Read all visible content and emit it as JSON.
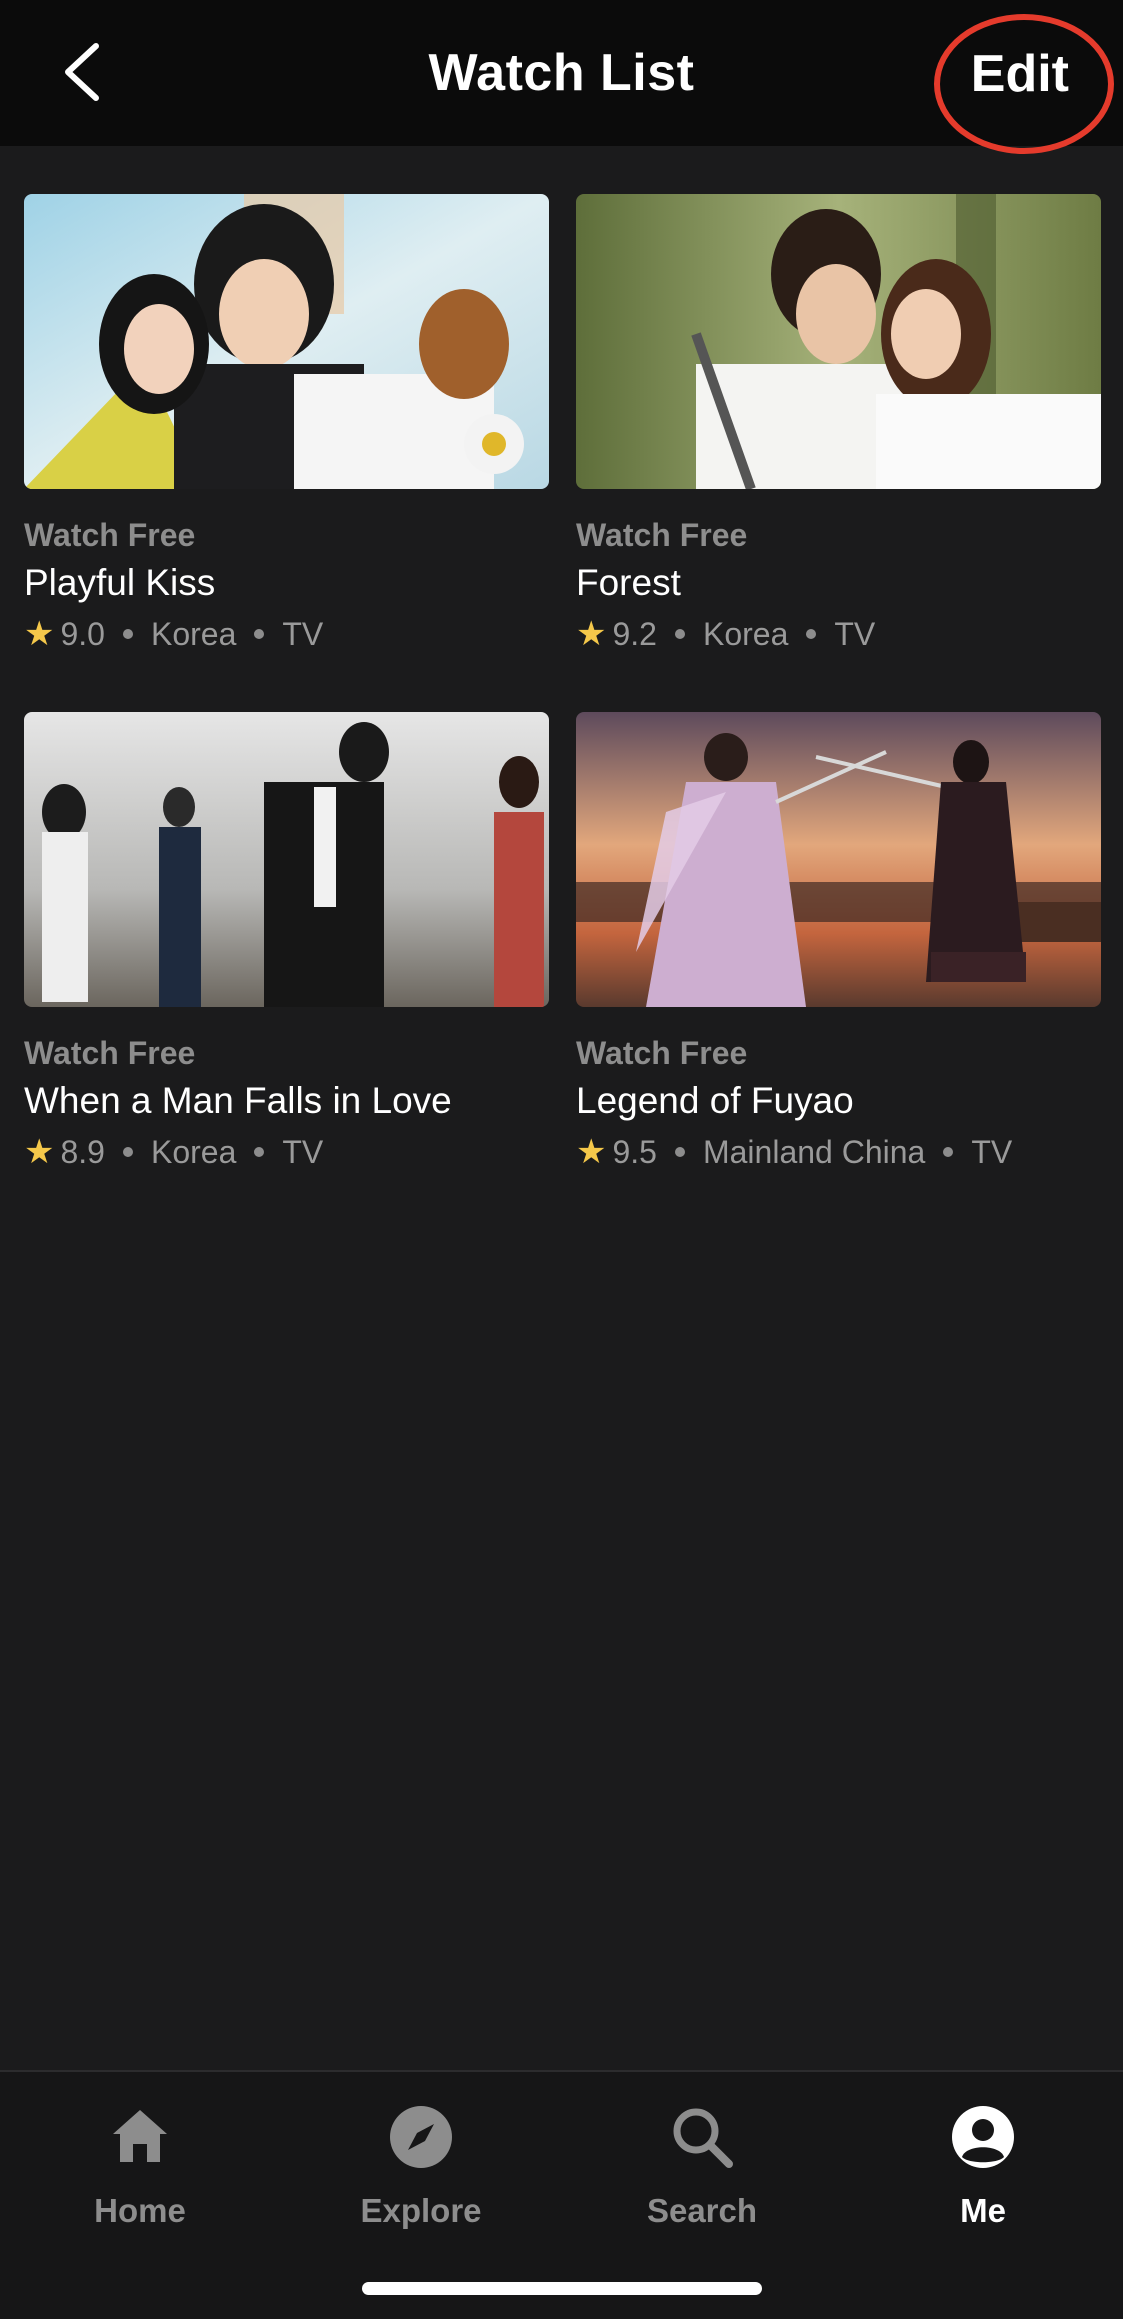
{
  "header": {
    "title": "Watch List",
    "edit_label": "Edit"
  },
  "items": [
    {
      "badge": "Watch Free",
      "title": "Playful Kiss",
      "rating": "9.0",
      "country": "Korea",
      "type": "TV"
    },
    {
      "badge": "Watch Free",
      "title": "Forest",
      "rating": "9.2",
      "country": "Korea",
      "type": "TV"
    },
    {
      "badge": "Watch Free",
      "title": "When a Man Falls in Love",
      "rating": "8.9",
      "country": "Korea",
      "type": "TV"
    },
    {
      "badge": "Watch Free",
      "title": "Legend of Fuyao",
      "rating": "9.5",
      "country": "Mainland China",
      "type": "TV"
    }
  ],
  "tabs": [
    {
      "label": "Home",
      "icon": "home-icon"
    },
    {
      "label": "Explore",
      "icon": "compass-icon"
    },
    {
      "label": "Search",
      "icon": "search-icon"
    },
    {
      "label": "Me",
      "icon": "profile-icon",
      "active": true
    }
  ],
  "colors": {
    "background": "#1b1b1c",
    "header": "#0b0b0b",
    "highlight": "#e53b2c",
    "star": "#f5c84a",
    "muted": "#8d8d8d"
  }
}
